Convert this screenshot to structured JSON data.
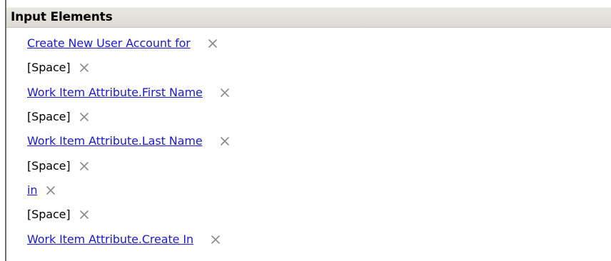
{
  "panel": {
    "title": "Input Elements"
  },
  "items": [
    {
      "label": "Create New User Account for",
      "type": "link"
    },
    {
      "label": "[Space]",
      "type": "text"
    },
    {
      "label": "Work Item Attribute.First Name",
      "type": "link"
    },
    {
      "label": "[Space]",
      "type": "text"
    },
    {
      "label": "Work Item Attribute.Last Name",
      "type": "link"
    },
    {
      "label": "[Space]",
      "type": "text"
    },
    {
      "label": "in",
      "type": "link"
    },
    {
      "label": "[Space]",
      "type": "text"
    },
    {
      "label": "Work Item Attribute.Create In",
      "type": "link"
    }
  ],
  "icons": {
    "remove": "close-icon"
  },
  "colors": {
    "link": "#1a1ad6",
    "header_bg": "#e0ded6",
    "remove_icon": "#8a8a8a"
  }
}
